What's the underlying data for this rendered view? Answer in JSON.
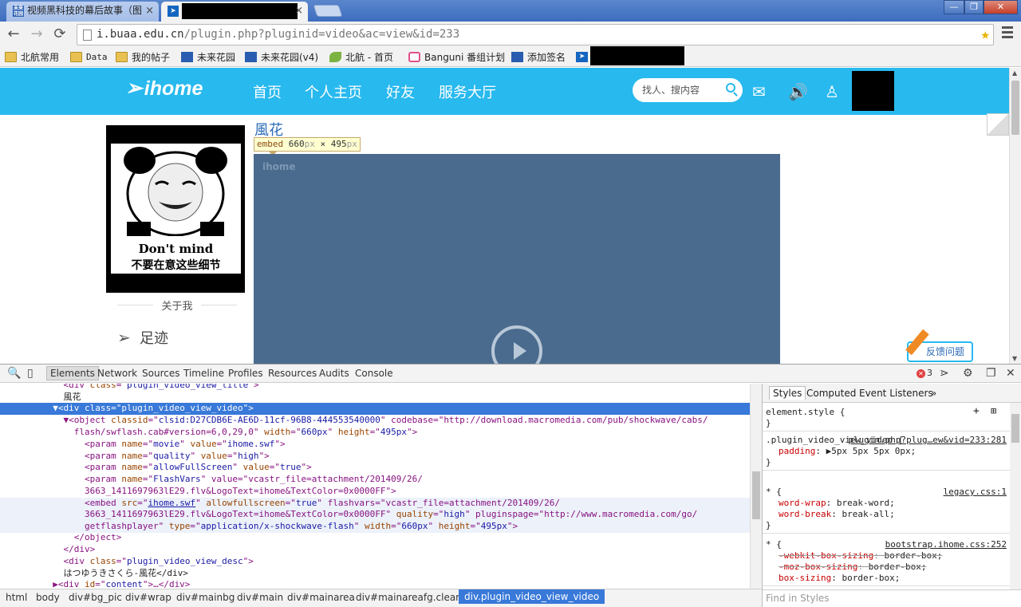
{
  "browser": {
    "tabs": [
      {
        "title": "视频黑科技的幕后故事（图",
        "close": "×"
      },
      {
        "title": "",
        "close": "×"
      }
    ],
    "window_controls": [
      "—",
      "❐",
      "✕"
    ],
    "url_host": "i.buaa.edu.cn",
    "url_path": "/plugin.php?pluginid=video&ac=view&id=233",
    "bookmarks": [
      "北航常用",
      "Data",
      "我的帖子",
      "未来花园",
      "未来花园(v4)",
      "北航 - 首页",
      "Banguni 番组计划",
      "添加签名"
    ]
  },
  "site": {
    "logo": "ihome",
    "nav": [
      "首页",
      "个人主页",
      "好友",
      "服务大厅"
    ],
    "search_placeholder": "找人、搜内容",
    "meme_line1": "Don't mind",
    "meme_line2": "不要在意这些细节",
    "about_label": "关于我",
    "footprint_label": "足迹",
    "video_title": "風花",
    "tooltip_tag": "embed",
    "tooltip_w": "660",
    "tooltip_h": "495",
    "tooltip_unit": "px",
    "tooltip_x": " × ",
    "player_watermark": "ihome",
    "feedback_label": "反馈问题"
  },
  "devtools": {
    "tabs": [
      "Elements",
      "Network",
      "Sources",
      "Timeline",
      "Profiles",
      "Resources",
      "Audits",
      "Console"
    ],
    "error_count": "3",
    "lines": [
      {
        "indent": "      ",
        "html": "<div class=\"plugin_video_view_title\">"
      },
      {
        "indent": "      ",
        "text": "風花"
      },
      {
        "indent": "    ",
        "html": "▼<div class=\"plugin_video_view_video\">"
      },
      {
        "indent": "      ",
        "html": "▼<object classid=\"clsid:D27CDB6E-AE6D-11cf-96B8-444553540000\" codebase=\"http://download.macromedia.com/pub/shockwave/cabs/"
      },
      {
        "indent": "      ",
        "html": "flash/swflash.cab#version=6,0,29,0\" width=\"660px\" height=\"495px\">"
      },
      {
        "indent": "          ",
        "html": "<param name=\"movie\" value=\"ihome.swf\">"
      },
      {
        "indent": "          ",
        "html": "<param name=\"quality\" value=\"high\">"
      },
      {
        "indent": "          ",
        "html": "<param name=\"allowFullScreen\" value=\"true\">"
      },
      {
        "indent": "          ",
        "html": "<param name=\"FlashVars\" value=\"vcastr_file=attachment/201409/26/"
      },
      {
        "indent": "          ",
        "html": "3663_1411697963lE29.flv&LogoText=ihome&TextColor=0x0000FF\">"
      },
      {
        "indent": "          ",
        "html": "<embed src=\"ihome.swf\" allowfullscreen=\"true\" flashvars=\"vcastr_file=attachment/201409/26/"
      },
      {
        "indent": "          ",
        "html": "3663_1411697963lE29.flv&LogoText=ihome&TextColor=0x0000FF\" quality=\"high\" pluginspage=\"http://www.macromedia.com/go/"
      },
      {
        "indent": "          ",
        "html": "getflashplayer\" type=\"application/x-shockwave-flash\" width=\"660px\" height=\"495px\">"
      },
      {
        "indent": "        ",
        "html": "</object>"
      },
      {
        "indent": "      ",
        "html": "</div>"
      },
      {
        "indent": "      ",
        "html": "<div class=\"plugin_video_view_desc\">"
      },
      {
        "indent": "      ",
        "text": "はつゆうきさくら-風花</div>"
      },
      {
        "indent": "    ",
        "html": "▶<div id=\"content\">…</div>"
      }
    ],
    "styles_tabs": [
      "Styles",
      "Computed",
      "Event Listeners",
      "»"
    ],
    "rules": [
      {
        "selector": "element.style {",
        "src": "",
        "decls": [],
        "close": "}"
      },
      {
        "selector": ".plugin_video_view_video {",
        "src": "plugin.php?plug…ew&vid=233:281",
        "decls": [
          {
            "p": "padding",
            "v": "▶5px 5px 5px 0px;"
          }
        ],
        "close": "}"
      },
      {
        "selector": "* {",
        "src": "legacy.css:1",
        "decls": [
          {
            "p": "word-wrap",
            "v": "break-word;"
          },
          {
            "p": "word-break",
            "v": "break-all;"
          }
        ],
        "close": "}"
      },
      {
        "selector": "* {",
        "src": "bootstrap.ihome.css:252",
        "decls": [
          {
            "p": "-webkit-box-sizing",
            "v": "border-box;"
          },
          {
            "p": "-moz-box-sizing",
            "v": "border-box;"
          },
          {
            "p": "box-sizing",
            "v": "border-box;"
          }
        ],
        "close": ""
      }
    ],
    "find_styles_placeholder": "Find in Styles",
    "breadcrumbs": [
      "html",
      "body",
      "div#bg_pic",
      "div#wrap",
      "div#mainbg",
      "div#main",
      "div#mainarea",
      "div#mainareafg.clearfix",
      "div.plugin_video_view_video"
    ]
  }
}
